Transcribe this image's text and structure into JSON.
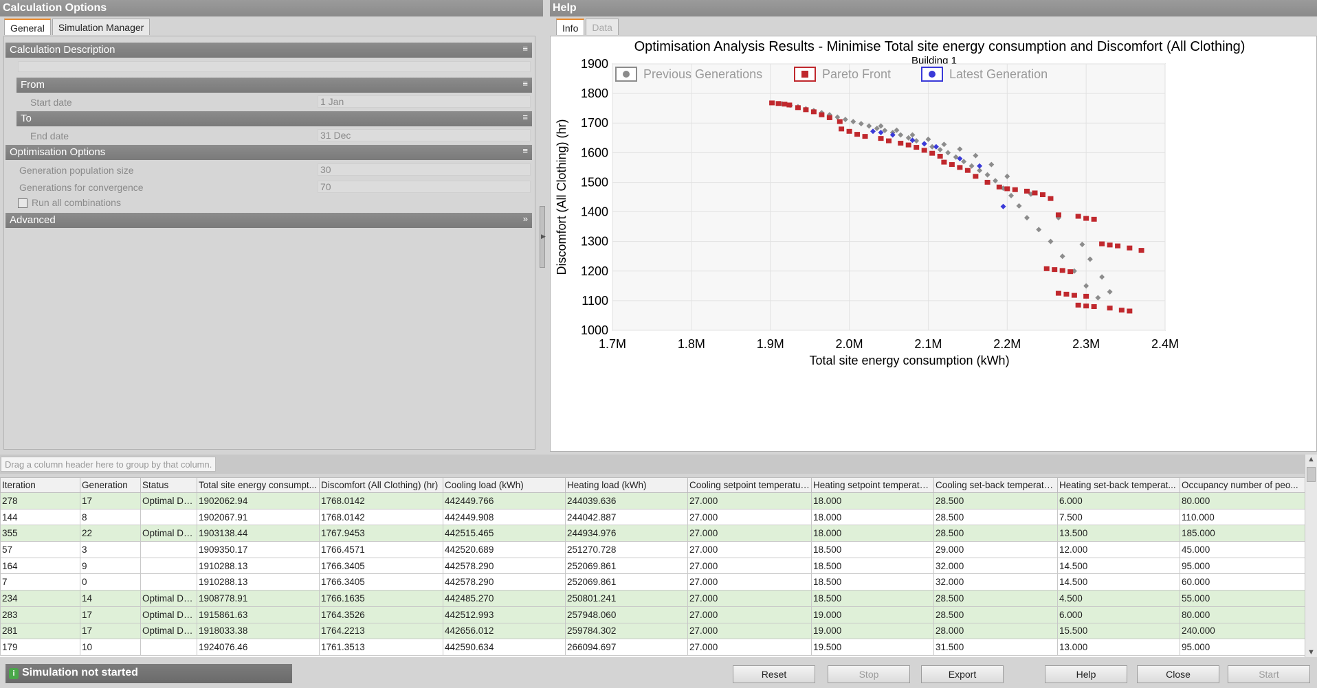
{
  "left": {
    "title": "Calculation Options",
    "tabs": [
      "General",
      "Simulation Manager"
    ],
    "sections": {
      "calc_description": "Calculation Description",
      "from": "From",
      "to": "To",
      "optimisation": "Optimisation Options",
      "advanced": "Advanced"
    },
    "fields": {
      "start_date_label": "Start date",
      "start_date_value": "1 Jan",
      "end_date_label": "End date",
      "end_date_value": "31 Dec",
      "pop_size_label": "Generation population size",
      "pop_size_value": "30",
      "gens_conv_label": "Generations for convergence",
      "gens_conv_value": "70",
      "run_all_label": "Run all combinations",
      "run_all_checked": false
    }
  },
  "help": {
    "title": "Help",
    "tabs": [
      "Info",
      "Data"
    ]
  },
  "chart_data": {
    "type": "scatter",
    "title": "Optimisation Analysis Results - Minimise Total site energy consumption and Discomfort (All Clothing)",
    "subtitle": "Building 1",
    "xlabel": "Total site energy consumption (kWh)",
    "ylabel": "Discomfort (All Clothing) (hr)",
    "xlim": [
      1700000,
      2400000
    ],
    "ylim": [
      1000,
      1900
    ],
    "xticks": [
      "1.7M",
      "1.8M",
      "1.9M",
      "2.0M",
      "2.1M",
      "2.2M",
      "2.3M",
      "2.4M"
    ],
    "yticks": [
      "1000",
      "1100",
      "1200",
      "1300",
      "1400",
      "1500",
      "1600",
      "1700",
      "1800",
      "1900"
    ],
    "grid": true,
    "legend_position": "top",
    "series": [
      {
        "name": "Previous Generations",
        "color": "#8c8c8c",
        "marker": "diamond",
        "points": [
          [
            1915000,
            1765
          ],
          [
            1925000,
            1760
          ],
          [
            1935000,
            1755
          ],
          [
            1945000,
            1748
          ],
          [
            1955000,
            1742
          ],
          [
            1965000,
            1735
          ],
          [
            1975000,
            1728
          ],
          [
            1985000,
            1720
          ],
          [
            1995000,
            1712
          ],
          [
            2005000,
            1705
          ],
          [
            2015000,
            1698
          ],
          [
            2025000,
            1690
          ],
          [
            2035000,
            1682
          ],
          [
            2045000,
            1675
          ],
          [
            2055000,
            1668
          ],
          [
            2065000,
            1660
          ],
          [
            2075000,
            1650
          ],
          [
            2085000,
            1640
          ],
          [
            2095000,
            1630
          ],
          [
            2105000,
            1620
          ],
          [
            2115000,
            1610
          ],
          [
            2125000,
            1600
          ],
          [
            2135000,
            1585
          ],
          [
            2145000,
            1570
          ],
          [
            2155000,
            1555
          ],
          [
            2165000,
            1540
          ],
          [
            2175000,
            1525
          ],
          [
            2185000,
            1505
          ],
          [
            2195000,
            1480
          ],
          [
            2205000,
            1455
          ],
          [
            2215000,
            1420
          ],
          [
            2225000,
            1380
          ],
          [
            2240000,
            1340
          ],
          [
            2255000,
            1300
          ],
          [
            2270000,
            1250
          ],
          [
            2285000,
            1200
          ],
          [
            2300000,
            1150
          ],
          [
            2315000,
            1110
          ],
          [
            2040000,
            1690
          ],
          [
            2060000,
            1676
          ],
          [
            2080000,
            1660
          ],
          [
            2100000,
            1645
          ],
          [
            2120000,
            1628
          ],
          [
            2140000,
            1612
          ],
          [
            2160000,
            1590
          ],
          [
            2180000,
            1560
          ],
          [
            2200000,
            1520
          ],
          [
            2230000,
            1460
          ],
          [
            2265000,
            1380
          ],
          [
            2295000,
            1290
          ],
          [
            2305000,
            1240
          ],
          [
            2320000,
            1180
          ],
          [
            2330000,
            1130
          ]
        ]
      },
      {
        "name": "Pareto Front",
        "color": "#c0282d",
        "marker": "square",
        "points": [
          [
            1902063,
            1768
          ],
          [
            1910288,
            1766
          ],
          [
            1918033,
            1764
          ],
          [
            1924076,
            1761
          ],
          [
            1935000,
            1752
          ],
          [
            1945000,
            1745
          ],
          [
            1955000,
            1738
          ],
          [
            1965000,
            1728
          ],
          [
            1975000,
            1718
          ],
          [
            1988000,
            1705
          ],
          [
            1990000,
            1680
          ],
          [
            2000000,
            1672
          ],
          [
            2010000,
            1662
          ],
          [
            2020000,
            1655
          ],
          [
            2040000,
            1648
          ],
          [
            2050000,
            1640
          ],
          [
            2065000,
            1632
          ],
          [
            2075000,
            1626
          ],
          [
            2085000,
            1618
          ],
          [
            2095000,
            1608
          ],
          [
            2105000,
            1598
          ],
          [
            2115000,
            1588
          ],
          [
            2120000,
            1568
          ],
          [
            2130000,
            1560
          ],
          [
            2140000,
            1550
          ],
          [
            2150000,
            1540
          ],
          [
            2160000,
            1520
          ],
          [
            2175000,
            1500
          ],
          [
            2190000,
            1484
          ],
          [
            2200000,
            1478
          ],
          [
            2210000,
            1475
          ],
          [
            2225000,
            1470
          ],
          [
            2235000,
            1464
          ],
          [
            2245000,
            1458
          ],
          [
            2255000,
            1445
          ],
          [
            2265000,
            1390
          ],
          [
            2290000,
            1385
          ],
          [
            2300000,
            1378
          ],
          [
            2310000,
            1375
          ],
          [
            2320000,
            1292
          ],
          [
            2330000,
            1288
          ],
          [
            2340000,
            1285
          ],
          [
            2355000,
            1278
          ],
          [
            2370000,
            1270
          ],
          [
            2250000,
            1208
          ],
          [
            2260000,
            1205
          ],
          [
            2270000,
            1202
          ],
          [
            2280000,
            1198
          ],
          [
            2265000,
            1125
          ],
          [
            2275000,
            1122
          ],
          [
            2285000,
            1118
          ],
          [
            2300000,
            1115
          ],
          [
            2290000,
            1085
          ],
          [
            2300000,
            1082
          ],
          [
            2310000,
            1080
          ],
          [
            2330000,
            1075
          ],
          [
            2345000,
            1068
          ],
          [
            2355000,
            1065
          ]
        ]
      },
      {
        "name": "Latest Generation",
        "color": "#3a3ad8",
        "marker": "diamond",
        "points": [
          [
            2030000,
            1672
          ],
          [
            2040000,
            1668
          ],
          [
            2055000,
            1660
          ],
          [
            2080000,
            1642
          ],
          [
            2095000,
            1630
          ],
          [
            2110000,
            1620
          ],
          [
            2140000,
            1580
          ],
          [
            2165000,
            1555
          ],
          [
            2195000,
            1418
          ]
        ]
      }
    ]
  },
  "grid": {
    "group_hint": "Drag a column header here to group by that column.",
    "columns": [
      "Iteration",
      "Generation",
      "Status",
      "Total site energy consumpt...",
      "Discomfort (All Clothing) (hr)",
      "Cooling load (kWh)",
      "Heating load (kWh)",
      "Cooling setpoint temperatur...",
      "Heating setpoint temperatu...",
      "Cooling set-back temperatu...",
      "Heating set-back temperat...",
      "Occupancy number of peo..."
    ],
    "rows": [
      {
        "opt": true,
        "cells": [
          "278",
          "17",
          "Optimal De...",
          "1902062.94",
          "1768.0142",
          "442449.766",
          "244039.636",
          "27.000",
          "18.000",
          "28.500",
          "6.000",
          "80.000"
        ]
      },
      {
        "opt": false,
        "cells": [
          "144",
          "8",
          "",
          "1902067.91",
          "1768.0142",
          "442449.908",
          "244042.887",
          "27.000",
          "18.000",
          "28.500",
          "7.500",
          "110.000"
        ]
      },
      {
        "opt": true,
        "cells": [
          "355",
          "22",
          "Optimal De...",
          "1903138.44",
          "1767.9453",
          "442515.465",
          "244934.976",
          "27.000",
          "18.000",
          "28.500",
          "13.500",
          "185.000"
        ]
      },
      {
        "opt": false,
        "cells": [
          "57",
          "3",
          "",
          "1909350.17",
          "1766.4571",
          "442520.689",
          "251270.728",
          "27.000",
          "18.500",
          "29.000",
          "12.000",
          "45.000"
        ]
      },
      {
        "opt": false,
        "cells": [
          "164",
          "9",
          "",
          "1910288.13",
          "1766.3405",
          "442578.290",
          "252069.861",
          "27.000",
          "18.500",
          "32.000",
          "14.500",
          "95.000"
        ]
      },
      {
        "opt": false,
        "cells": [
          "7",
          "0",
          "",
          "1910288.13",
          "1766.3405",
          "442578.290",
          "252069.861",
          "27.000",
          "18.500",
          "32.000",
          "14.500",
          "60.000"
        ]
      },
      {
        "opt": true,
        "cells": [
          "234",
          "14",
          "Optimal De...",
          "1908778.91",
          "1766.1635",
          "442485.270",
          "250801.241",
          "27.000",
          "18.500",
          "28.500",
          "4.500",
          "55.000"
        ]
      },
      {
        "opt": true,
        "cells": [
          "283",
          "17",
          "Optimal De...",
          "1915861.63",
          "1764.3526",
          "442512.993",
          "257948.060",
          "27.000",
          "19.000",
          "28.500",
          "6.000",
          "80.000"
        ]
      },
      {
        "opt": true,
        "cells": [
          "281",
          "17",
          "Optimal De...",
          "1918033.38",
          "1764.2213",
          "442656.012",
          "259784.302",
          "27.000",
          "19.000",
          "28.000",
          "15.500",
          "240.000"
        ]
      },
      {
        "opt": false,
        "cells": [
          "179",
          "10",
          "",
          "1924076.46",
          "1761.3513",
          "442590.634",
          "266094.697",
          "27.000",
          "19.500",
          "31.500",
          "13.000",
          "95.000"
        ]
      }
    ]
  },
  "status": {
    "text": "Simulation not started",
    "icon": "info-icon"
  },
  "buttons": {
    "reset": "Reset",
    "stop": "Stop",
    "export": "Export",
    "help": "Help",
    "close": "Close",
    "start": "Start"
  }
}
